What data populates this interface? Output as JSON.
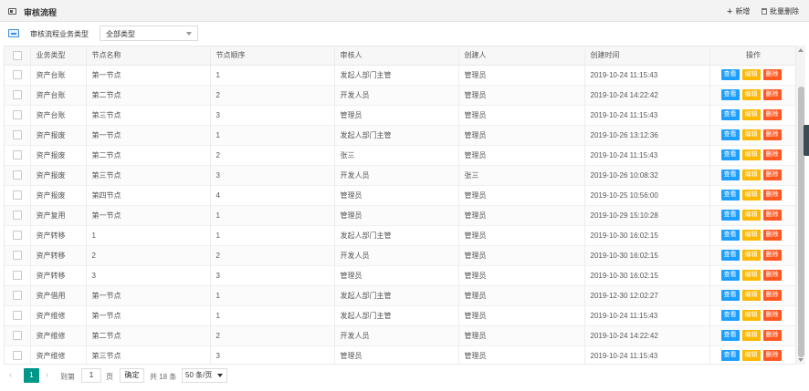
{
  "header": {
    "title": "审核流程",
    "add_label": "新增",
    "batch_delete_label": "批量删除"
  },
  "filter": {
    "label": "审核流程业务类型",
    "selected": "全部类型"
  },
  "table": {
    "columns": [
      "业务类型",
      "节点名称",
      "节点顺序",
      "审核人",
      "创建人",
      "创建时间",
      "操作"
    ],
    "actions": {
      "view": "查看",
      "edit": "编辑",
      "delete": "删除"
    },
    "rows": [
      [
        "资产台账",
        "第一节点",
        "1",
        "发起人部门主管",
        "管理员",
        "2019-10-24 11:15:43"
      ],
      [
        "资产台账",
        "第二节点",
        "2",
        "开发人员",
        "管理员",
        "2019-10-24 14:22:42"
      ],
      [
        "资产台账",
        "第三节点",
        "3",
        "管理员",
        "管理员",
        "2019-10-24 11:15:43"
      ],
      [
        "资产报废",
        "第一节点",
        "1",
        "发起人部门主管",
        "管理员",
        "2019-10-26 13:12:36"
      ],
      [
        "资产报废",
        "第二节点",
        "2",
        "张三",
        "管理员",
        "2019-10-24 11:15:43"
      ],
      [
        "资产报废",
        "第三节点",
        "3",
        "开发人员",
        "张三",
        "2019-10-26 10:08:32"
      ],
      [
        "资产报废",
        "第四节点",
        "4",
        "管理员",
        "管理员",
        "2019-10-25 10:56:00"
      ],
      [
        "资产复用",
        "第一节点",
        "1",
        "管理员",
        "管理员",
        "2019-10-29 15:10:28"
      ],
      [
        "资产转移",
        "1",
        "1",
        "发起人部门主管",
        "管理员",
        "2019-10-30 16:02:15"
      ],
      [
        "资产转移",
        "2",
        "2",
        "开发人员",
        "管理员",
        "2019-10-30 16:02:15"
      ],
      [
        "资产转移",
        "3",
        "3",
        "管理员",
        "管理员",
        "2019-10-30 16:02:15"
      ],
      [
        "资产借用",
        "第一节点",
        "1",
        "发起人部门主管",
        "管理员",
        "2019-12-30 12:02:27"
      ],
      [
        "资产维修",
        "第一节点",
        "1",
        "发起人部门主管",
        "管理员",
        "2019-10-24 11:15:43"
      ],
      [
        "资产维修",
        "第二节点",
        "2",
        "开发人员",
        "管理员",
        "2019-10-24 14:22:42"
      ],
      [
        "资产维修",
        "第三节点",
        "3",
        "管理员",
        "管理员",
        "2019-10-24 11:15:43"
      ]
    ]
  },
  "pagination": {
    "prev_icon": "chevron-left-icon",
    "current_page": "1",
    "next_icon": "chevron-right-icon",
    "goto_label": "到第",
    "page_input": "1",
    "page_unit": "页",
    "confirm_label": "确定",
    "total_label": "共 18 条",
    "page_size": "50 条/页"
  }
}
